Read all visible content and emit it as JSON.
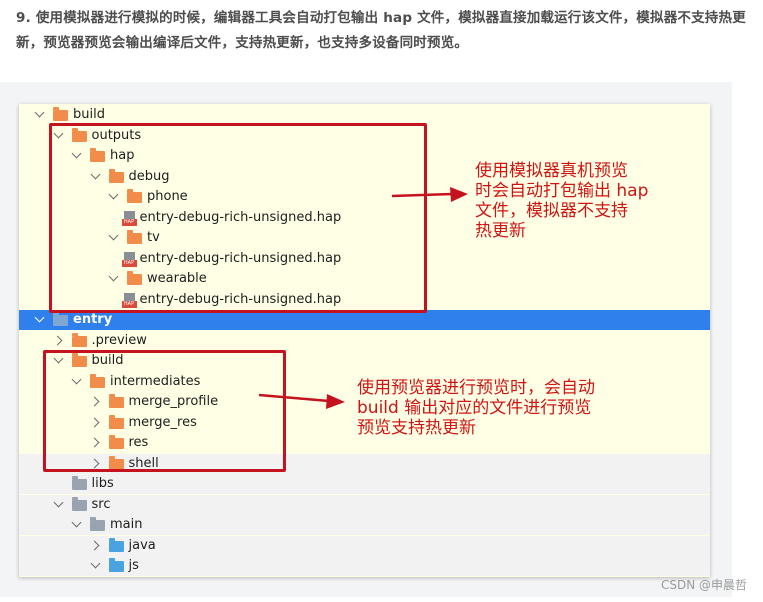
{
  "intro": {
    "text": "9. 使用模拟器进行模拟的时候，编辑器工具会自动打包输出 hap 文件，模拟器直接加载运行该文件，模拟器不支持热更新，预览器预览会输出编译后文件，支持热更新，也支持多设备同时预览。"
  },
  "tree": [
    {
      "label": "build",
      "chevron": "down",
      "icon": "folder",
      "level": 0
    },
    {
      "label": "outputs",
      "chevron": "down",
      "icon": "folder",
      "level": 1
    },
    {
      "label": "hap",
      "chevron": "down",
      "icon": "folder",
      "level": 2
    },
    {
      "label": "debug",
      "chevron": "down",
      "icon": "folder",
      "level": 3
    },
    {
      "label": "phone",
      "chevron": "down",
      "icon": "folder",
      "level": 4
    },
    {
      "label": "entry-debug-rich-unsigned.hap",
      "chevron": "none",
      "icon": "hap-file",
      "level": 5
    },
    {
      "label": "tv",
      "chevron": "down",
      "icon": "folder",
      "level": 4
    },
    {
      "label": "entry-debug-rich-unsigned.hap",
      "chevron": "none",
      "icon": "hap-file",
      "level": 5
    },
    {
      "label": "wearable",
      "chevron": "down",
      "icon": "folder",
      "level": 4
    },
    {
      "label": "entry-debug-rich-unsigned.hap",
      "chevron": "none",
      "icon": "hap-file",
      "level": 5
    },
    {
      "label": "entry",
      "chevron": "down",
      "icon": "module-folder",
      "level": 0,
      "selected": true
    },
    {
      "label": ".preview",
      "chevron": "right",
      "icon": "folder",
      "level": 1
    },
    {
      "label": "build",
      "chevron": "down",
      "icon": "folder",
      "level": 1
    },
    {
      "label": "intermediates",
      "chevron": "down",
      "icon": "folder",
      "level": 2
    },
    {
      "label": "merge_profile",
      "chevron": "right",
      "icon": "folder",
      "level": 3
    },
    {
      "label": "merge_res",
      "chevron": "right",
      "icon": "folder",
      "level": 3
    },
    {
      "label": "res",
      "chevron": "right",
      "icon": "folder",
      "level": 3
    },
    {
      "label": "shell",
      "chevron": "right",
      "icon": "folder",
      "level": 3
    },
    {
      "label": "libs",
      "chevron": "none",
      "icon": "gray-folder",
      "level": 1
    },
    {
      "label": "src",
      "chevron": "down",
      "icon": "gray-folder",
      "level": 1
    },
    {
      "label": "main",
      "chevron": "down",
      "icon": "gray-folder",
      "level": 2
    },
    {
      "label": "java",
      "chevron": "right",
      "icon": "blue-folder",
      "level": 3
    },
    {
      "label": "js",
      "chevron": "down",
      "icon": "blue-folder",
      "level": 3
    }
  ],
  "hap_tag": "HAP",
  "annotations": {
    "simulator_note": [
      "使用模拟器真机预览",
      "时会自动打包输出 hap",
      "文件，模拟器不支持",
      "热更新"
    ],
    "preview_note": [
      "使用预览器进行预览时，会自动",
      "build 输出对应的文件进行预览",
      "预览支持热更新"
    ]
  },
  "watermark": "CSDN @申晨哲",
  "colors": {
    "highlight_red": "#c4121f",
    "selected_blue": "#2f80ed",
    "folder_orange": "#f28c4a",
    "panel_yellow": "#ffffe6"
  }
}
